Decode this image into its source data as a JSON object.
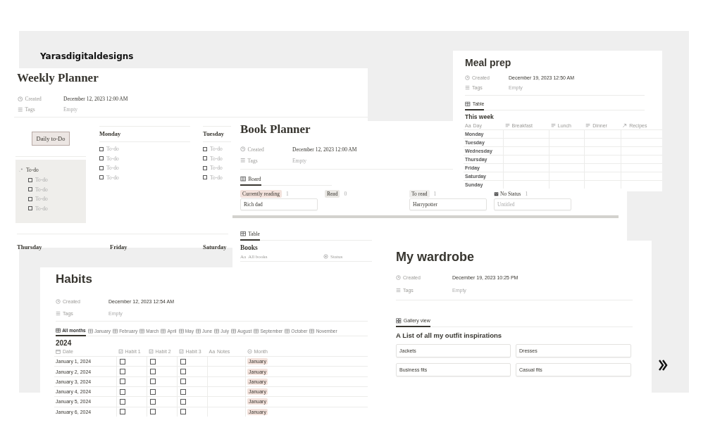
{
  "brand": "Yarasdigitaldesigns",
  "weekly_planner": {
    "title": "Weekly Planner",
    "properties": [
      {
        "kind": "created",
        "label": "Created",
        "value": "December 12, 2023 12:00 AM"
      },
      {
        "kind": "tags",
        "label": "Tags",
        "value": "Empty"
      }
    ],
    "button": "Daily to-Do",
    "todo_block": {
      "title": "To-do",
      "items": [
        {
          "text": "To-do",
          "checked": false
        },
        {
          "text": "To-do",
          "checked": false
        },
        {
          "text": "To-do",
          "checked": false
        },
        {
          "text": "To-do",
          "checked": false
        }
      ]
    },
    "days": [
      {
        "name": "Monday",
        "items": [
          {
            "text": "To-do",
            "checked": false
          },
          {
            "text": "To-do",
            "checked": false
          },
          {
            "text": "To-do",
            "checked": false
          },
          {
            "text": "To-do",
            "checked": false
          }
        ]
      },
      {
        "name": "Tuesday",
        "items": [
          {
            "text": "To-do",
            "checked": false
          },
          {
            "text": "To-do",
            "checked": false
          },
          {
            "text": "To-do",
            "checked": false
          },
          {
            "text": "To-do",
            "checked": false
          }
        ]
      }
    ],
    "days_row_2": [
      "Thursday",
      "Friday",
      "Saturday"
    ]
  },
  "book_planner": {
    "title": "Book Planner",
    "properties": [
      {
        "kind": "created",
        "label": "Created",
        "value": "December 12, 2023 12:00 AM"
      },
      {
        "kind": "tags",
        "label": "Tags",
        "value": "Empty"
      }
    ],
    "view_tab": "Board",
    "columns": [
      {
        "kind": "status",
        "name": "Currently reading",
        "count": "1",
        "color": "#f3e2dc",
        "cards": [
          {
            "kind": "named",
            "title": "Rich dad"
          }
        ]
      },
      {
        "kind": "status",
        "name": "Read",
        "count": "0",
        "color": "#e9e7e3"
      },
      {
        "kind": "status",
        "name": "To read",
        "count": "1",
        "color": "#efeeec",
        "cards": [
          {
            "kind": "named",
            "title": "Harrypotter"
          }
        ]
      },
      {
        "kind": "none",
        "name": "No Status",
        "count": "1",
        "cards": [
          {
            "kind": "untitled",
            "title": "Untitled"
          }
        ]
      }
    ],
    "table_view": {
      "tab": "Table",
      "title": "Books",
      "columns": [
        {
          "kind": "title",
          "icon": "Aa",
          "label": "All books"
        },
        {
          "kind": "status",
          "label": "Status"
        }
      ]
    }
  },
  "meal_prep": {
    "title": "Meal prep",
    "properties": [
      {
        "kind": "created",
        "label": "Created",
        "value": "December 19, 2023 12:50 AM"
      },
      {
        "kind": "tags",
        "label": "Tags",
        "value": "Empty"
      }
    ],
    "view_tab": "Table",
    "table_title": "This week",
    "columns": [
      {
        "kind": "title",
        "icon": "Aa",
        "label": "Day"
      },
      {
        "kind": "text",
        "label": "Breakfast"
      },
      {
        "kind": "text",
        "label": "Lunch"
      },
      {
        "kind": "text",
        "label": "Dinner"
      },
      {
        "kind": "relation",
        "label": "Recipes"
      }
    ],
    "rows": [
      "Monday",
      "Tuesday",
      "Wednesday",
      "Thursday",
      "Friday",
      "Saturday",
      "Sunday"
    ]
  },
  "habits": {
    "title": "Habits",
    "properties": [
      {
        "kind": "created",
        "label": "Created",
        "value": "December 12, 2023 12:54 AM"
      },
      {
        "kind": "tags",
        "label": "Tags",
        "value": "Empty"
      }
    ],
    "tabs": [
      {
        "label": "All months",
        "selected": true
      },
      {
        "label": "January",
        "selected": false
      },
      {
        "label": "February",
        "selected": false
      },
      {
        "label": "March",
        "selected": false
      },
      {
        "label": "April",
        "selected": false
      },
      {
        "label": "May",
        "selected": false
      },
      {
        "label": "June",
        "selected": false
      },
      {
        "label": "July",
        "selected": false
      },
      {
        "label": "August",
        "selected": false
      },
      {
        "label": "September",
        "selected": false
      },
      {
        "label": "October",
        "selected": false
      },
      {
        "label": "November",
        "selected": false
      }
    ],
    "table_title": "2024",
    "columns": [
      {
        "kind": "date",
        "label": "Date"
      },
      {
        "kind": "checkbox",
        "label": "Habit 1"
      },
      {
        "kind": "checkbox",
        "label": "Habit 2"
      },
      {
        "kind": "checkbox",
        "label": "Habit 3"
      },
      {
        "kind": "text",
        "icon": "Aa",
        "label": "Notes"
      },
      {
        "kind": "select",
        "label": "Month"
      }
    ],
    "rows": [
      {
        "date": "January 1, 2024",
        "habits": [
          false,
          false,
          false
        ],
        "month": "January"
      },
      {
        "date": "January 2, 2024",
        "habits": [
          false,
          false,
          false
        ],
        "month": "January"
      },
      {
        "date": "January 3, 2024",
        "habits": [
          false,
          false,
          false
        ],
        "month": "January"
      },
      {
        "date": "January 4, 2024",
        "habits": [
          false,
          false,
          false
        ],
        "month": "January"
      },
      {
        "date": "January 5, 2024",
        "habits": [
          false,
          false,
          false
        ],
        "month": "January"
      },
      {
        "date": "January 6, 2024",
        "habits": [
          false,
          false,
          false
        ],
        "month": "January"
      }
    ]
  },
  "wardrobe": {
    "title": "My wardrobe",
    "properties": [
      {
        "kind": "created",
        "label": "Created",
        "value": "December 19, 2023 10:25 PM"
      },
      {
        "kind": "tags",
        "label": "Tags",
        "value": "Empty"
      }
    ],
    "view_tab": "Gallery view",
    "heading": "A List of all my outfit inspirations",
    "cards": [
      "Jackets",
      "Dresses",
      "Business fits",
      "Casual fits"
    ]
  }
}
